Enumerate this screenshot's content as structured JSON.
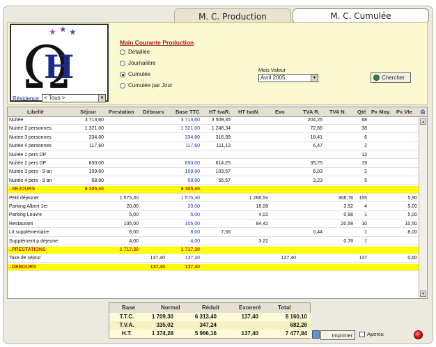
{
  "tabs": [
    "M. C. Production",
    "M. C. Cumulée"
  ],
  "filters": {
    "title": "Main Courante Production",
    "options": [
      "Détaillée",
      "Journalière",
      "Cumulée",
      "Cumulée par Jour"
    ],
    "selected": "Cumulée",
    "residence_label": "Résidence",
    "residence_value": "< Tous >",
    "mois_label": "Mois Valeur",
    "mois_value": "Avril 2005",
    "search_button": "Chercher"
  },
  "grid": {
    "columns": [
      "Libellé",
      "Séjour",
      "Prestation",
      "Débours",
      "Base TTC",
      "HT tvaR.",
      "HT tvaN.",
      "Exo",
      "TVA R.",
      "TVA N.",
      "Qté",
      "Px Moy.",
      "Px Vte"
    ],
    "rows": [
      {
        "lib": "Nuitée",
        "sej": "3 713,60",
        "pre": "",
        "deb": "",
        "base": "3 713,60",
        "htr": "3 509,35",
        "htn": "",
        "exo": "",
        "tvar": "204,25",
        "tvan": "",
        "qte": "68",
        "pxm": "",
        "pxv": "",
        "type": "data"
      },
      {
        "lib": "Nuitée 2 personnes",
        "sej": "1 321,00",
        "pre": "",
        "deb": "",
        "base": "1 321,00",
        "htr": "1 248,34",
        "htn": "",
        "exo": "",
        "tvar": "72,66",
        "tvan": "",
        "qte": "38",
        "pxm": "",
        "pxv": "",
        "type": "data"
      },
      {
        "lib": "Nuitée 3 personnes",
        "sej": "334,80",
        "pre": "",
        "deb": "",
        "base": "334,80",
        "htr": "316,39",
        "htn": "",
        "exo": "",
        "tvar": "18,41",
        "tvan": "",
        "qte": "6",
        "pxm": "",
        "pxv": "",
        "type": "data"
      },
      {
        "lib": "Nuitée 4 personnes",
        "sej": "117,60",
        "pre": "",
        "deb": "",
        "base": "117,60",
        "htr": "111,13",
        "htn": "",
        "exo": "",
        "tvar": "6,47",
        "tvan": "",
        "qte": "2",
        "pxm": "",
        "pxv": "",
        "type": "data"
      },
      {
        "lib": "Nuitée 1 pers DP",
        "sej": "",
        "pre": "",
        "deb": "",
        "base": "",
        "htr": "",
        "htn": "",
        "exo": "",
        "tvar": "",
        "tvan": "",
        "qte": "13",
        "pxm": "",
        "pxv": "",
        "type": "data"
      },
      {
        "lib": "Nuitée 2 pers DP",
        "sej": "650,00",
        "pre": "",
        "deb": "",
        "base": "650,00",
        "htr": "614,25",
        "htn": "",
        "exo": "",
        "tvar": "35,75",
        "tvan": "",
        "qte": "19",
        "pxm": "",
        "pxv": "",
        "type": "data"
      },
      {
        "lib": "Nuitée 3 pers - 9 an",
        "sej": "109,60",
        "pre": "",
        "deb": "",
        "base": "109,60",
        "htr": "103,57",
        "htn": "",
        "exo": "",
        "tvar": "6,03",
        "tvan": "",
        "qte": "2",
        "pxm": "",
        "pxv": "",
        "type": "data"
      },
      {
        "lib": "Nuitée 4 pers - 9 an",
        "sej": "58,80",
        "pre": "",
        "deb": "",
        "base": "58,80",
        "htr": "55,57",
        "htn": "",
        "exo": "",
        "tvar": "3,23",
        "tvan": "",
        "qte": "5",
        "pxm": "",
        "pxv": "",
        "type": "data"
      },
      {
        "lib": "..SEJOURS",
        "sej": "6 305,40",
        "pre": "",
        "deb": "",
        "base": "6 305,40",
        "htr": "",
        "htn": "",
        "exo": "",
        "tvar": "",
        "tvan": "",
        "qte": "",
        "pxm": "",
        "pxv": "",
        "type": "total"
      },
      {
        "lib": "Petit déjeuner",
        "sej": "",
        "pre": "1 575,30",
        "deb": "",
        "base": "1 575,30",
        "htr": "",
        "htn": "1 266,54",
        "exo": "",
        "tvar": "",
        "tvan": "308,76",
        "qte": "155",
        "pxm": "",
        "pxv": "5,90",
        "type": "data"
      },
      {
        "lib": "Parking Albert 1er",
        "sej": "",
        "pre": "20,00",
        "deb": "",
        "base": "20,00",
        "htr": "",
        "htn": "16,08",
        "exo": "",
        "tvar": "",
        "tvan": "3,92",
        "qte": "4",
        "pxm": "",
        "pxv": "5,00",
        "type": "data"
      },
      {
        "lib": "Parking Louvre",
        "sej": "",
        "pre": "5,00",
        "deb": "",
        "base": "5,00",
        "htr": "",
        "htn": "4,02",
        "exo": "",
        "tvar": "",
        "tvan": "0,98",
        "qte": "1",
        "pxm": "",
        "pxv": "5,00",
        "type": "data"
      },
      {
        "lib": "Restaurant",
        "sej": "",
        "pre": "105,00",
        "deb": "",
        "base": "105,00",
        "htr": "",
        "htn": "84,42",
        "exo": "",
        "tvar": "",
        "tvan": "20,58",
        "qte": "10",
        "pxm": "",
        "pxv": "10,50",
        "type": "data"
      },
      {
        "lib": "Lit supplémentaire",
        "sej": "",
        "pre": "8,00",
        "deb": "",
        "base": "8,00",
        "htr": "7,56",
        "htn": "",
        "exo": "",
        "tvar": "0,44",
        "tvan": "",
        "qte": "1",
        "pxm": "",
        "pxv": "8,00",
        "type": "data"
      },
      {
        "lib": "Supplément p.déjeune",
        "sej": "",
        "pre": "4,00",
        "deb": "",
        "base": "4,00",
        "htr": "",
        "htn": "3,22",
        "exo": "",
        "tvar": "",
        "tvan": "0,78",
        "qte": "1",
        "pxm": "",
        "pxv": "",
        "type": "data"
      },
      {
        "lib": "..PRESTATIONS",
        "sej": "",
        "pre": "1 717,30",
        "deb": "",
        "base": "1 717,30",
        "htr": "",
        "htn": "",
        "exo": "",
        "tvar": "",
        "tvan": "",
        "qte": "",
        "pxm": "",
        "pxv": "",
        "type": "total"
      },
      {
        "lib": "Taxe de séjour",
        "sej": "",
        "pre": "",
        "deb": "137,40",
        "base": "137,40",
        "htr": "",
        "htn": "",
        "exo": "137,40",
        "tvar": "",
        "tvan": "",
        "qte": "137",
        "pxm": "",
        "pxv": "0,60",
        "type": "data"
      },
      {
        "lib": "..DEBOURS",
        "sej": "",
        "pre": "",
        "deb": "137,40",
        "base": "137,40",
        "htr": "",
        "htn": "",
        "exo": "",
        "tvar": "",
        "tvan": "",
        "qte": "",
        "pxm": "",
        "pxv": "",
        "type": "total"
      }
    ]
  },
  "summary": {
    "headers": [
      "Base",
      "Normal",
      "Réduit",
      "Exoneré",
      "Total"
    ],
    "rows": [
      {
        "label": "T.T.C.",
        "normal": "1 709,30",
        "reduit": "6 313,40",
        "exo": "137,40",
        "total": "8 160,10"
      },
      {
        "label": "T.V.A.",
        "normal": "335,02",
        "reduit": "347,24",
        "exo": "",
        "total": "682,26"
      },
      {
        "label": "H.T.",
        "normal": "1 374,28",
        "reduit": "5 966,16",
        "exo": "137,40",
        "total": "7 477,84"
      }
    ]
  },
  "footer": {
    "print_button": "Imprimer",
    "preview_label": "Apercu"
  }
}
